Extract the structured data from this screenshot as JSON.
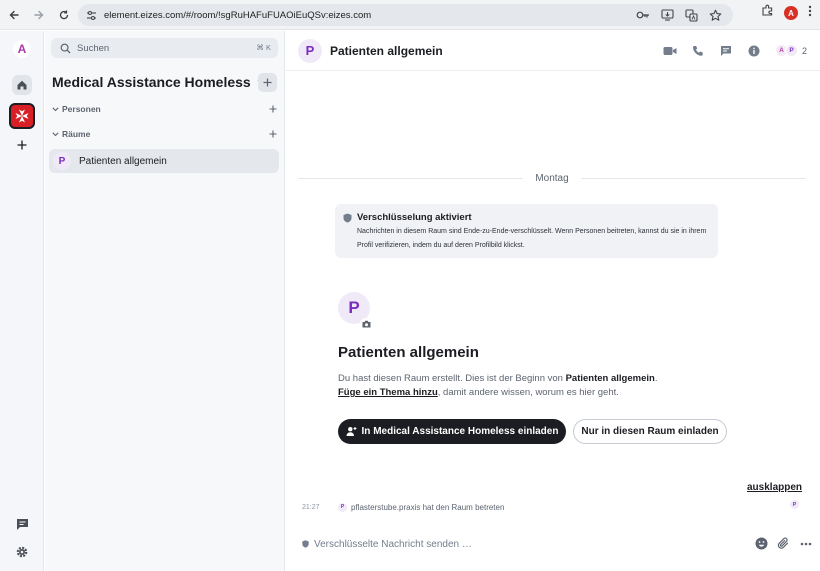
{
  "browser": {
    "url": "element.eizes.com/#/room/!sgRuHAFuFUAOiEuQSv:eizes.com",
    "profile_initial": "A"
  },
  "spacebar": {
    "account_initial": "A"
  },
  "roomlist": {
    "search_placeholder": "Suchen",
    "search_shortcut": "⌘ K",
    "space_name": "Medical Assistance Homeless",
    "sections": [
      {
        "label": "Personen"
      },
      {
        "label": "Räume"
      }
    ],
    "rooms": [
      {
        "avatar": "P",
        "name": "Patienten allgemein"
      }
    ]
  },
  "room": {
    "avatar": "P",
    "title": "Patienten allgemein",
    "facepile": [
      "A",
      "P"
    ],
    "member_count": "2",
    "date_separator": "Montag",
    "encryption": {
      "title": "Verschlüsselung aktiviert",
      "body": "Nachrichten in diesem Raum sind Ende-zu-Ende-verschlüsselt. Wenn Personen beitreten, kannst du sie in ihrem Profil verifizieren, indem du auf deren Profilbild klickst."
    },
    "intro": {
      "title": "Patienten allgemein",
      "line1_prefix": "Du hast diesen Raum erstellt. Dies ist der Beginn von ",
      "line1_room": "Patienten allgemein",
      "line1_suffix": ".",
      "topic_link": "Füge ein Thema hinzu",
      "line2_suffix": ", damit andere wissen, worum es hier geht."
    },
    "buttons": {
      "invite_space": "In Medical Assistance Homeless einladen",
      "invite_room": "Nur in diesen Raum einladen"
    },
    "expand_label": "ausklappen",
    "event": {
      "time": "21:27",
      "avatar": "P",
      "text": "pflasterstube.praxis hat den Raum betreten"
    },
    "receipt_avatar": "P",
    "composer_placeholder": "Verschlüsselte Nachricht senden …"
  },
  "colors": {
    "accent_purple": "#7b2cbf",
    "space_logo_red": "#d91f26",
    "primary_button": "#1b1d22"
  }
}
